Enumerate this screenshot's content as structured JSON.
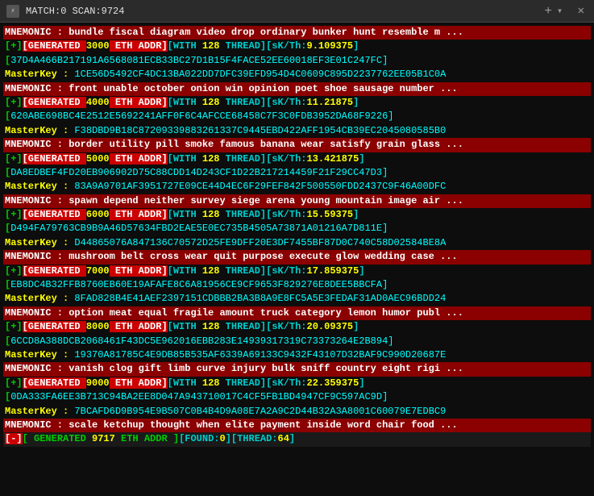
{
  "titlebar": {
    "icon": "⚡",
    "title": "MATCH:0 SCAN:9724",
    "close": "✕",
    "add": "+",
    "dropdown": "▾"
  },
  "blocks": [
    {
      "mnemonic": "MNEMONIC : bundle fiscal diagram video drop ordinary bunker hunt resemble m ...",
      "generated": "[+][GENERATED 3000 ETH ADDR][WITH 128 THREAD][sK/Th:9.109375]",
      "addr": "37D4A466B217191A6568081ECB33BC27D1B15F4FACE52EE60018EF3E01C247FC]",
      "masterkey_label": "MasterKey :",
      "masterkey_val": "1CE56D5492CF4DC13BA022DD7DFC39EFD954D4C0609C895D2237762EE05B1C0A"
    },
    {
      "mnemonic": "MNEMONIC : front unable october onion win opinion poet shoe sausage number ...",
      "generated": "[+][GENERATED 4000 ETH ADDR][WITH 128 THREAD][sK/Th:11.21875]",
      "addr": "620ABE698BC4E2512E5692241AFF0F6C4AFCCE68458C7F3C0FDB3952DA68F9226]",
      "masterkey_label": "MasterKey :",
      "masterkey_val": "F38DBD9B18C87209339883261337C9445EBD422AFF1954CB39EC2045080585B0"
    },
    {
      "mnemonic": "MNEMONIC : border utility pill smoke famous banana wear satisfy grain glass ...",
      "generated": "[+][GENERATED 5000 ETH ADDR][WITH 128 THREAD][sK/Th:13.421875]",
      "addr": "DA8EDBEF4FD20EB906902D75C88CDD14D243CF1D22B217214459F21F29CC47D3]",
      "masterkey_label": "MasterKey :",
      "masterkey_val": "83A9A9701AF3951727E09CE44D4EC6F29FEF842F500550FDD2437C9F46A00DFC"
    },
    {
      "mnemonic": "MNEMONIC : spawn depend neither survey siege arena young mountain image air ...",
      "generated": "[+][GENERATED 6000 ETH ADDR][WITH 128 THREAD][sK/Th:15.59375]",
      "addr": "D494FA79763CB9B9A46D57634FBD2EAE5E0EC735B4505A73871A01216A7D811E]",
      "masterkey_label": "MasterKey :",
      "masterkey_val": "D44865076A847136C70572D25FE9DFF20E3DF7455BF87D0C740C58D02584BE8A"
    },
    {
      "mnemonic": "MNEMONIC : mushroom belt cross wear quit purpose execute glow wedding case ...",
      "generated": "[+][GENERATED 7000 ETH ADDR][WITH 128 THREAD][sK/Th:17.859375]",
      "addr": "EB8DC4B32FFB8760EB60E19AFAFE8C6A81956CE9CF9653F829276E8DEE5BBCFA]",
      "masterkey_label": "MasterKey :",
      "masterkey_val": "8FAD828B4E41AEF2397151CDBBB2BA3B8A9E8FC5A5E3FEDAF31AD0AEC96BDD24"
    },
    {
      "mnemonic": "MNEMONIC : option meat equal fragile amount truck category lemon humor publ ...",
      "generated": "[+][GENERATED 8000 ETH ADDR][WITH 128 THREAD][sK/Th:20.09375]",
      "addr": "6CCD8A388DCB2068461F43DC5E962016EBB283E14939317319C73373264E2B894]",
      "masterkey_label": "MasterKey :",
      "masterkey_val": "19370A81785C4E9DB85B535AF6339A69133C9432F43107D32BAF9C990D20687E"
    },
    {
      "mnemonic": "MNEMONIC : vanish clog gift limb curve injury bulk sniff country eight rigi ...",
      "generated": "[+][GENERATED 9000 ETH ADDR][WITH 128 THREAD][sK/Th:22.359375]",
      "addr": "0DA333FA6EE3B713C94BA2EE8D047A943710017C4CF5FB1BD4947CF9C597AC9D]",
      "masterkey_label": "MasterKey :",
      "masterkey_val": "7BCAFD6D9B954E9B507C0B4B4D9A08E7A2A9C2D44B32A3A8001C60079E7EDBC9"
    },
    {
      "mnemonic": "MNEMONIC : scale ketchup thought when elite payment inside word chair food ...",
      "generated": "[-][ GENERATED 9717 ETH ADDR ][FOUND:0][THREAD:64]",
      "is_status": true
    }
  ]
}
